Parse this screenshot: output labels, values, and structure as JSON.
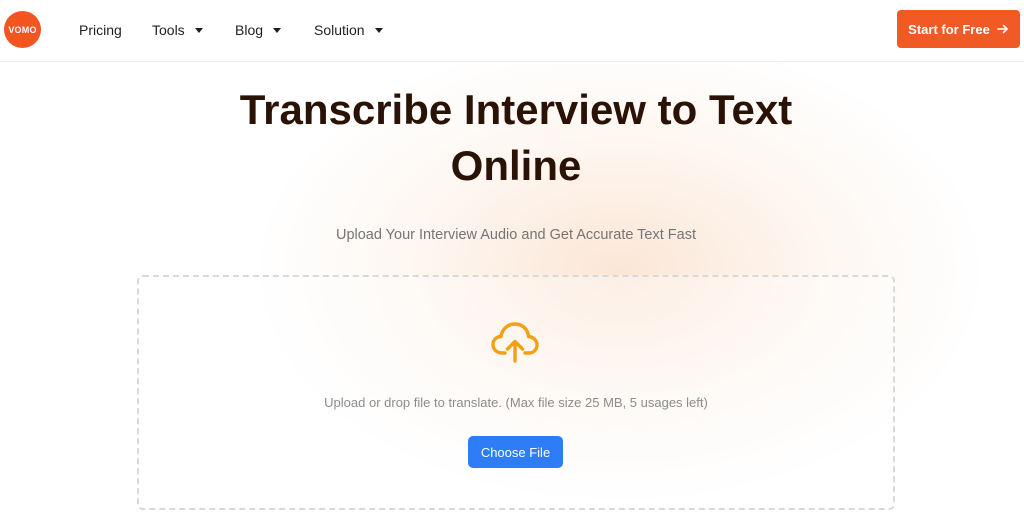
{
  "brand": {
    "logo_text": "VOMO",
    "accent_color": "#f15a24"
  },
  "nav": {
    "items": [
      {
        "label": "Pricing",
        "has_dropdown": false
      },
      {
        "label": "Tools",
        "has_dropdown": true
      },
      {
        "label": "Blog",
        "has_dropdown": true
      },
      {
        "label": "Solution",
        "has_dropdown": true
      }
    ],
    "cta_label": "Start for Free",
    "cta_icon": "arrow-right-icon"
  },
  "hero": {
    "title_line1": "Transcribe Interview to Text",
    "title_line2": "Online",
    "subtitle": "Upload Your Interview Audio and Get Accurate Text Fast"
  },
  "upload": {
    "icon": "cloud-upload-icon",
    "icon_color": "#f5a012",
    "hint": "Upload or drop file to translate. (Max file size 25 MB, 5 usages left)",
    "button_label": "Choose File",
    "button_color": "#2f7df6"
  }
}
